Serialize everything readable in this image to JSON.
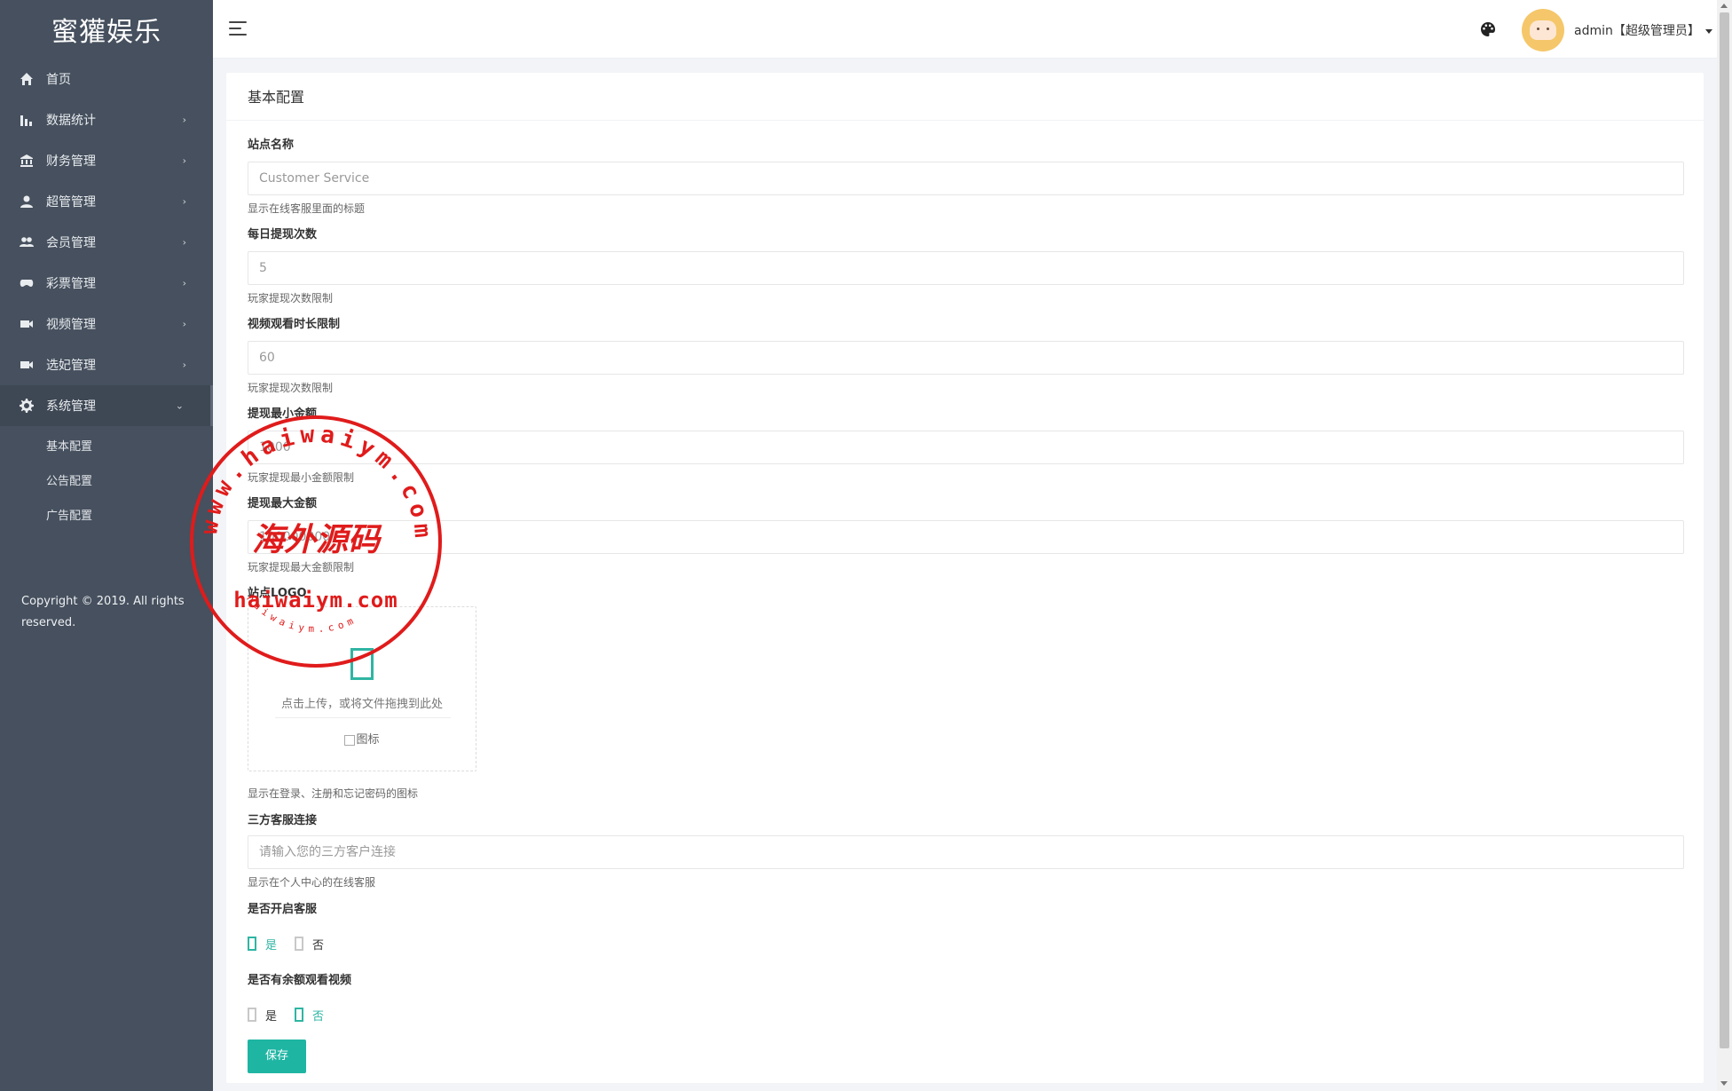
{
  "app": {
    "brand": "蜜獾娱乐"
  },
  "sidebar": {
    "items": [
      {
        "label": "首页",
        "icon": "home-icon",
        "has_children": false
      },
      {
        "label": "数据统计",
        "icon": "bar-chart-icon",
        "has_children": true
      },
      {
        "label": "财务管理",
        "icon": "bank-icon",
        "has_children": true
      },
      {
        "label": "超管管理",
        "icon": "user-icon",
        "has_children": true
      },
      {
        "label": "会员管理",
        "icon": "users-icon",
        "has_children": true
      },
      {
        "label": "彩票管理",
        "icon": "gamepad-icon",
        "has_children": true
      },
      {
        "label": "视频管理",
        "icon": "video-icon",
        "has_children": true
      },
      {
        "label": "选妃管理",
        "icon": "video-icon",
        "has_children": true
      },
      {
        "label": "系统管理",
        "icon": "gear-icon",
        "has_children": true,
        "expanded": true
      }
    ],
    "submenu": [
      "基本配置",
      "公告配置",
      "广告配置"
    ],
    "copyright": "Copyright © 2019. All rights reserved."
  },
  "header": {
    "user_label": "admin【超级管理员】",
    "icons": [
      "hamburger-icon",
      "palette-icon"
    ]
  },
  "card": {
    "title": "基本配置",
    "fields": {
      "site_name": {
        "label": "站点名称",
        "placeholder": "Customer Service",
        "hint": "显示在线客服里面的标题"
      },
      "daily_withdraw": {
        "label": "每日提现次数",
        "placeholder": "5",
        "hint": "玩家提现次数限制"
      },
      "video_limit": {
        "label": "视频观看时长限制",
        "placeholder": "60",
        "hint": "玩家提现次数限制"
      },
      "min_withdraw": {
        "label": "提现最小金额",
        "placeholder": "1000",
        "hint": "玩家提现最小金额限制"
      },
      "max_withdraw": {
        "label": "提现最大金额",
        "placeholder": "100000000",
        "hint": "玩家提现最大金额限制"
      },
      "logo": {
        "label": "站点LOGO",
        "upload_text": "点击上传，或将文件拖拽到此处",
        "img_alt": "图标",
        "hint": "显示在登录、注册和忘记密码的图标"
      },
      "third_party": {
        "label": "三方客服连接",
        "placeholder": "请输入您的三方客户连接",
        "hint": "显示在个人中心的在线客服"
      },
      "enable_service": {
        "label": "是否开启客服",
        "options": [
          "是",
          "否"
        ],
        "selected": "是"
      },
      "balance_video": {
        "label": "是否有余额观看视频",
        "options": [
          "是",
          "否"
        ],
        "selected": "否"
      }
    },
    "save_label": "保存"
  },
  "watermark": {
    "outer_text": "www.haiwaiym.com",
    "center_text": "海外源码",
    "domain_text": "haiwaiym.com",
    "small_text": "haiwaiym.com",
    "color": "#e01b1b"
  },
  "colors": {
    "sidebar_bg": "#46505e",
    "accent": "#1fb5a3"
  }
}
